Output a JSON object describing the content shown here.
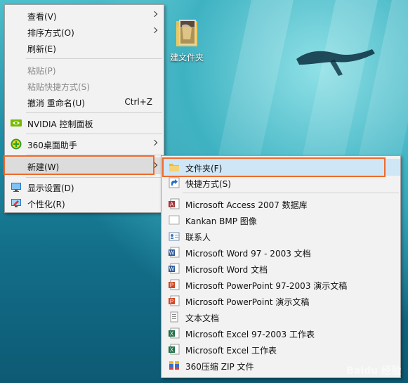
{
  "desktop": {
    "folder_label": "建文件夹",
    "watermark": "Baidu 经验"
  },
  "context_menu": {
    "items": [
      {
        "label": "查看(V)",
        "submenu": true
      },
      {
        "label": "排序方式(O)",
        "submenu": true
      },
      {
        "label": "刷新(E)"
      },
      {
        "label": "粘贴(P)",
        "disabled": true
      },
      {
        "label": "粘贴快捷方式(S)",
        "disabled": true
      },
      {
        "label": "撤消 重命名(U)",
        "shortcut": "Ctrl+Z"
      },
      {
        "label": "NVIDIA 控制面板",
        "icon": "nvidia-icon"
      },
      {
        "label": "360桌面助手",
        "icon": "360-desktop-icon",
        "submenu": true
      },
      {
        "label": "新建(W)",
        "submenu": true,
        "highlighted": true
      },
      {
        "label": "显示设置(D)",
        "icon": "display-settings-icon"
      },
      {
        "label": "个性化(R)",
        "icon": "personalize-icon"
      }
    ]
  },
  "new_submenu": {
    "items": [
      {
        "label": "文件夹(F)",
        "icon": "folder-icon",
        "highlighted": true
      },
      {
        "label": "快捷方式(S)",
        "icon": "shortcut-icon"
      },
      {
        "label": "Microsoft Access 2007 数据库",
        "icon": "access-icon"
      },
      {
        "label": "Kankan BMP 图像",
        "icon": "bmp-image-icon"
      },
      {
        "label": "联系人",
        "icon": "contact-icon"
      },
      {
        "label": "Microsoft Word 97 - 2003 文档",
        "icon": "word-icon"
      },
      {
        "label": "Microsoft Word 文档",
        "icon": "word-icon"
      },
      {
        "label": "Microsoft PowerPoint 97-2003 演示文稿",
        "icon": "powerpoint-icon"
      },
      {
        "label": "Microsoft PowerPoint 演示文稿",
        "icon": "powerpoint-icon"
      },
      {
        "label": "文本文档",
        "icon": "text-document-icon"
      },
      {
        "label": "Microsoft Excel 97-2003 工作表",
        "icon": "excel-icon"
      },
      {
        "label": "Microsoft Excel 工作表",
        "icon": "excel-icon"
      },
      {
        "label": "360压缩 ZIP 文件",
        "icon": "zip-archive-icon"
      }
    ]
  },
  "colors": {
    "highlight_box": "#ef6a2c",
    "menu_bg": "#f2f2f2"
  }
}
